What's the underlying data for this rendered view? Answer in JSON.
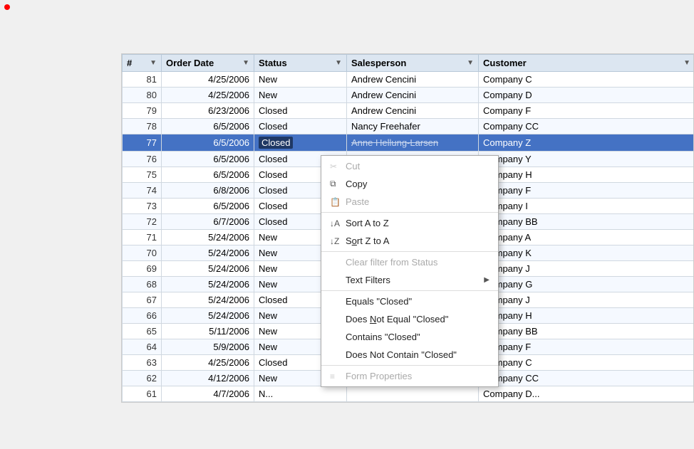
{
  "dot": {
    "color": "red"
  },
  "table": {
    "columns": [
      {
        "label": "#",
        "filter": true,
        "class": "col-num"
      },
      {
        "label": "Order Date",
        "filter": true,
        "class": "col-date"
      },
      {
        "label": "Status",
        "filter": true,
        "class": "col-status"
      },
      {
        "label": "Salesperson",
        "filter": true,
        "class": "col-sales"
      },
      {
        "label": "Customer",
        "filter": true,
        "class": "col-cust"
      }
    ],
    "rows": [
      {
        "num": "81",
        "date": "4/25/2006",
        "status": "New",
        "sales": "Andrew Cencini",
        "customer": "Company C",
        "highlight": false
      },
      {
        "num": "80",
        "date": "4/25/2006",
        "status": "New",
        "sales": "Andrew Cencini",
        "customer": "Company D",
        "highlight": false
      },
      {
        "num": "79",
        "date": "6/23/2006",
        "status": "Closed",
        "sales": "Andrew Cencini",
        "customer": "Company F",
        "highlight": false
      },
      {
        "num": "78",
        "date": "6/5/2006",
        "status": "Closed",
        "sales": "Nancy Freehafer",
        "customer": "Company CC",
        "highlight": false
      },
      {
        "num": "77",
        "date": "6/5/2006",
        "status": "Closed",
        "sales": "Anne Hellung-Larsen",
        "customer": "Company Z",
        "highlight": true
      },
      {
        "num": "76",
        "date": "6/5/2006",
        "status": "Closed",
        "sales": "",
        "customer": "Company Y",
        "highlight": false
      },
      {
        "num": "75",
        "date": "6/5/2006",
        "status": "Closed",
        "sales": "",
        "customer": "Company H",
        "highlight": false
      },
      {
        "num": "74",
        "date": "6/8/2006",
        "status": "Closed",
        "sales": "",
        "customer": "Company F",
        "highlight": false
      },
      {
        "num": "73",
        "date": "6/5/2006",
        "status": "Closed",
        "sales": "",
        "customer": "Company I",
        "highlight": false
      },
      {
        "num": "72",
        "date": "6/7/2006",
        "status": "Closed",
        "sales": "",
        "customer": "Company BB",
        "highlight": false
      },
      {
        "num": "71",
        "date": "5/24/2006",
        "status": "New",
        "sales": "",
        "customer": "Company A",
        "highlight": false
      },
      {
        "num": "70",
        "date": "5/24/2006",
        "status": "New",
        "sales": "",
        "customer": "Company K",
        "highlight": false
      },
      {
        "num": "69",
        "date": "5/24/2006",
        "status": "New",
        "sales": "",
        "customer": "Company J",
        "highlight": false
      },
      {
        "num": "68",
        "date": "5/24/2006",
        "status": "New",
        "sales": "",
        "customer": "Company G",
        "highlight": false
      },
      {
        "num": "67",
        "date": "5/24/2006",
        "status": "Closed",
        "sales": "",
        "customer": "Company J",
        "highlight": false
      },
      {
        "num": "66",
        "date": "5/24/2006",
        "status": "New",
        "sales": "",
        "customer": "Company H",
        "highlight": false
      },
      {
        "num": "65",
        "date": "5/11/2006",
        "status": "New",
        "sales": "",
        "customer": "Company BB",
        "highlight": false
      },
      {
        "num": "64",
        "date": "5/9/2006",
        "status": "New",
        "sales": "",
        "customer": "Company F",
        "highlight": false
      },
      {
        "num": "63",
        "date": "4/25/2006",
        "status": "Closed",
        "sales": "",
        "customer": "Company C",
        "highlight": false
      },
      {
        "num": "62",
        "date": "4/12/2006",
        "status": "New",
        "sales": "",
        "customer": "Company CC",
        "highlight": false
      },
      {
        "num": "61",
        "date": "4/7/2006",
        "status": "N...",
        "sales": "",
        "customer": "Company D...",
        "highlight": false
      }
    ]
  },
  "context_menu": {
    "items": [
      {
        "id": "cut",
        "icon": "✂",
        "label": "Cut",
        "disabled": true,
        "separator_after": false,
        "has_arrow": false
      },
      {
        "id": "copy",
        "icon": "⧉",
        "label": "Copy",
        "disabled": false,
        "separator_after": false,
        "has_arrow": false
      },
      {
        "id": "paste",
        "icon": "📋",
        "label": "Paste",
        "disabled": true,
        "separator_after": true,
        "has_arrow": false
      },
      {
        "id": "sort-az",
        "icon": "↓A",
        "label": "Sort A to Z",
        "disabled": false,
        "separator_after": false,
        "has_arrow": false
      },
      {
        "id": "sort-za",
        "icon": "↓Z",
        "label": "Sort Z to A",
        "disabled": false,
        "separator_after": true,
        "has_arrow": false
      },
      {
        "id": "clear-filter",
        "icon": "",
        "label": "Clear filter from Status",
        "disabled": true,
        "separator_after": false,
        "has_arrow": false
      },
      {
        "id": "text-filters",
        "icon": "",
        "label": "Text Filters",
        "disabled": false,
        "separator_after": true,
        "has_arrow": true
      },
      {
        "id": "equals",
        "icon": "",
        "label": "Equals \"Closed\"",
        "disabled": false,
        "separator_after": false,
        "has_arrow": false
      },
      {
        "id": "not-equal",
        "icon": "",
        "label": "Does Not Equal \"Closed\"",
        "disabled": false,
        "separator_after": false,
        "has_arrow": false
      },
      {
        "id": "contains",
        "icon": "",
        "label": "Contains \"Closed\"",
        "disabled": false,
        "separator_after": false,
        "has_arrow": false
      },
      {
        "id": "not-contain",
        "icon": "",
        "label": "Does Not Contain \"Closed\"",
        "disabled": false,
        "separator_after": true,
        "has_arrow": false
      },
      {
        "id": "form-props",
        "icon": "≡",
        "label": "Form Properties",
        "disabled": true,
        "separator_after": false,
        "has_arrow": false
      }
    ]
  }
}
